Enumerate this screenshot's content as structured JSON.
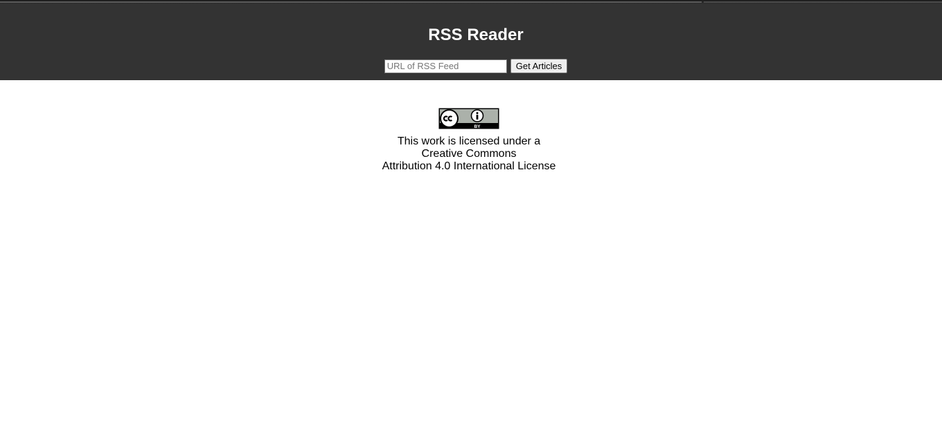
{
  "header": {
    "title": "RSS Reader",
    "background_color": "#333333"
  },
  "feed_form": {
    "input_value": "",
    "input_placeholder": "URL of RSS Feed",
    "button_label": "Get Articles"
  },
  "license": {
    "badge_icon": "cc-by-icon",
    "badge_text": "BY",
    "line1": "This work is licensed under a",
    "line2": "Creative Commons",
    "line3": "Attribution 4.0 International License"
  }
}
